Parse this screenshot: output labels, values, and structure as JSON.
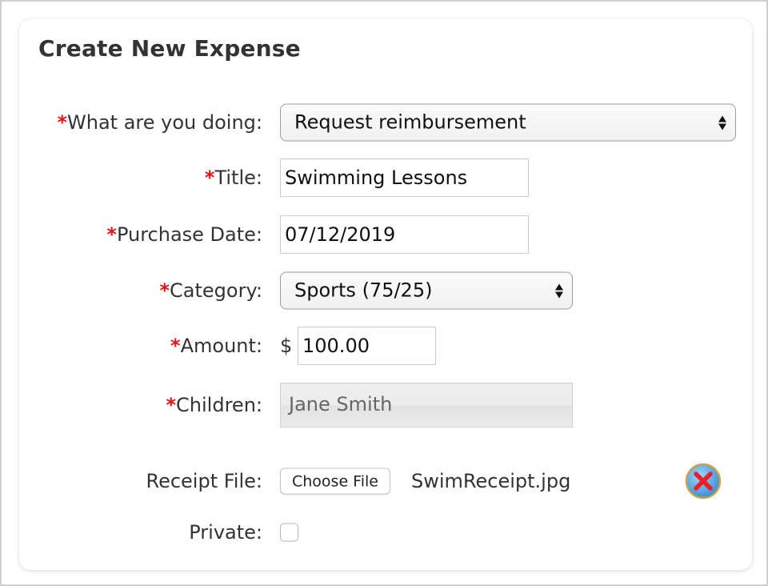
{
  "form": {
    "title": "Create New Expense",
    "required_marker": "*",
    "fields": {
      "activity": {
        "label": "What are you doing:",
        "required": true,
        "type": "select",
        "value": "Request reimbursement"
      },
      "title": {
        "label": "Title:",
        "required": true,
        "type": "text",
        "value": "Swimming Lessons"
      },
      "purchase_date": {
        "label": "Purchase Date:",
        "required": true,
        "type": "text",
        "value": "07/12/2019"
      },
      "category": {
        "label": "Category:",
        "required": true,
        "type": "select",
        "value": "Sports (75/25)"
      },
      "amount": {
        "label": "Amount:",
        "required": true,
        "currency_symbol": "$",
        "type": "text",
        "value": "100.00"
      },
      "children": {
        "label": "Children:",
        "required": true,
        "type": "readonly",
        "value": "Jane Smith"
      },
      "receipt_file": {
        "label": "Receipt File:",
        "required": false,
        "button_label": "Choose File",
        "file_name": "SwimReceipt.jpg",
        "remove_icon": "remove-file-icon"
      },
      "private": {
        "label": "Private:",
        "required": false,
        "checked": false
      }
    }
  },
  "colors": {
    "required_marker": "#ee1111",
    "label_text": "#333333",
    "remove_icon_fill": "#5aaee8",
    "remove_icon_x": "#e8202a"
  }
}
